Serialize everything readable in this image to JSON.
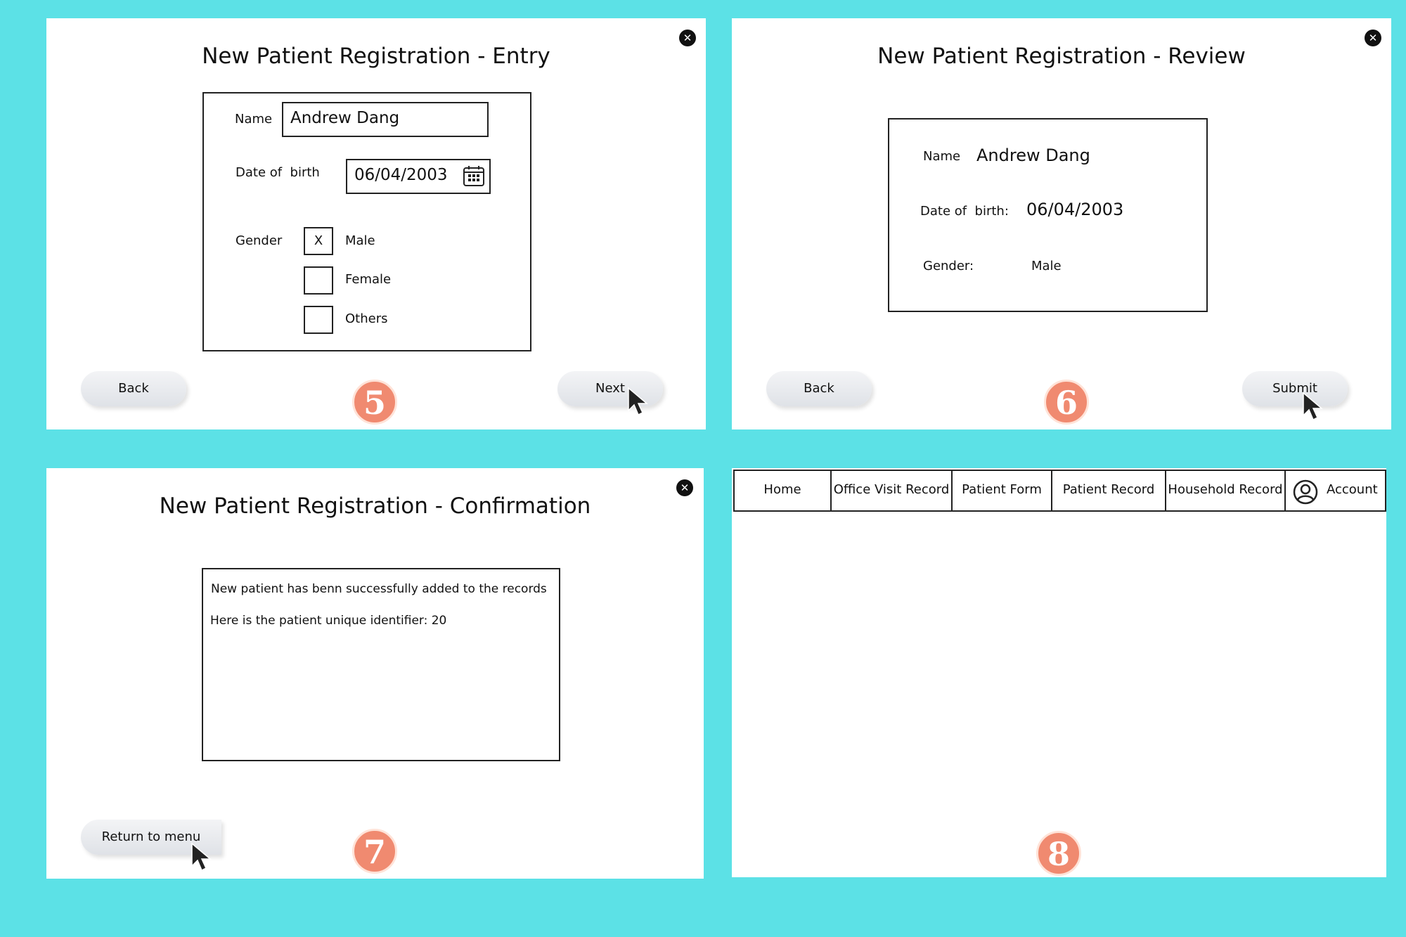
{
  "panel5": {
    "title": "New Patient Registration - Entry",
    "name_label": "Name",
    "name_value": "Andrew Dang",
    "dob_label": "Date of  birth",
    "dob_value": "06/04/2003",
    "gender_label": "Gender",
    "options": [
      {
        "label": "Male",
        "mark": "X"
      },
      {
        "label": "Female",
        "mark": ""
      },
      {
        "label": "Others",
        "mark": ""
      }
    ],
    "back_label": "Back",
    "next_label": "Next",
    "step": "5"
  },
  "panel6": {
    "title": "New Patient Registration - Review",
    "name_label": "Name",
    "name_value": "Andrew Dang",
    "dob_label": "Date of  birth:",
    "dob_value": "06/04/2003",
    "gender_label": "Gender:",
    "gender_value": "Male",
    "back_label": "Back",
    "submit_label": "Submit",
    "step": "6"
  },
  "panel7": {
    "title": "New Patient Registration - Confirmation",
    "line1": "New patient has benn successfully added to the records",
    "line2": "Here is the patient unique identifier: 20",
    "return_label": "Return to menu",
    "step": "7"
  },
  "panel8": {
    "tabs": [
      "Home",
      "Office Visit Record",
      "Patient Form",
      "Patient Record",
      "Household Record"
    ],
    "account_label": "Account",
    "step": "8"
  },
  "icons": {
    "close": "close-icon",
    "calendar": "calendar-icon",
    "cursor": "cursor-arrow-icon",
    "account": "user-avatar-icon"
  },
  "colors": {
    "background": "#5ce1e6",
    "badge": "#f08a70"
  }
}
